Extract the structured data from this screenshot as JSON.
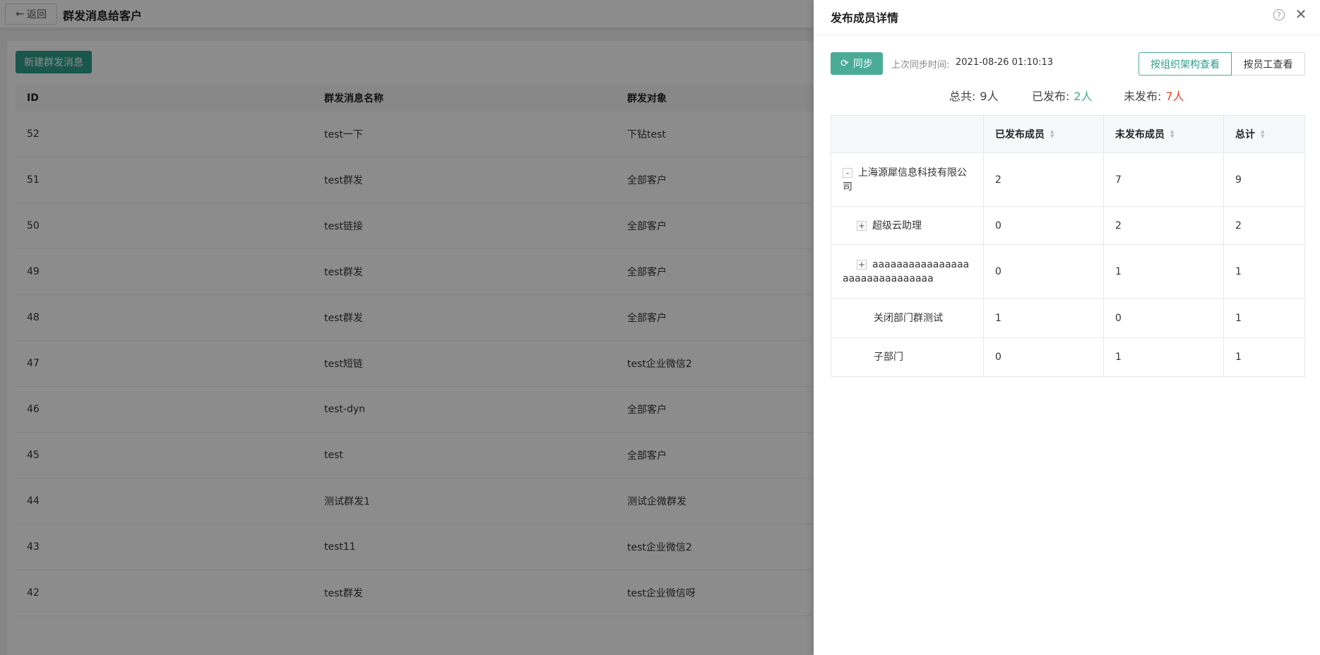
{
  "page": {
    "back_label": "返回",
    "title": "群发消息给客户",
    "new_button": "新建群发消息",
    "columns": [
      "ID",
      "群发消息名称",
      "群发对象"
    ],
    "rows": [
      {
        "id": "52",
        "name": "test一下",
        "target": "下钻test"
      },
      {
        "id": "51",
        "name": "test群发",
        "target": "全部客户"
      },
      {
        "id": "50",
        "name": "test链接",
        "target": "全部客户"
      },
      {
        "id": "49",
        "name": "test群发",
        "target": "全部客户"
      },
      {
        "id": "48",
        "name": "test群发",
        "target": "全部客户"
      },
      {
        "id": "47",
        "name": "test短链",
        "target": "test企业微信2"
      },
      {
        "id": "46",
        "name": "test-dyn",
        "target": "全部客户"
      },
      {
        "id": "45",
        "name": "test",
        "target": "全部客户"
      },
      {
        "id": "44",
        "name": "测试群发1",
        "target": "测试企微群发"
      },
      {
        "id": "43",
        "name": "test11",
        "target": "test企业微信2"
      },
      {
        "id": "42",
        "name": "test群发",
        "target": "test企业微信呀"
      }
    ]
  },
  "drawer": {
    "title": "发布成员详情",
    "help_icon": "question-circle-icon",
    "close_icon": "close-icon",
    "sync_button": "同步",
    "sync_label": "上次同步时间:",
    "sync_time": "2021-08-26 01:10:13",
    "view_by_org": "按组织架构查看",
    "view_by_staff": "按员工查看",
    "summary": {
      "total_label": "总共:",
      "total_value": "9人",
      "published_label": "已发布:",
      "published_value": "2人",
      "unpublished_label": "未发布:",
      "unpublished_value": "7人"
    },
    "columns": [
      "",
      "已发布成员",
      "未发布成员",
      "总计"
    ],
    "rows": [
      {
        "toggle": "-",
        "name": "上海源犀信息科技有限公司",
        "published": "2",
        "unpublished": "7",
        "total": "9"
      },
      {
        "toggle": "+",
        "name": "超级云助理",
        "published": "0",
        "unpublished": "2",
        "total": "2"
      },
      {
        "toggle": "+",
        "name": "aaaaaaaaaaaaaaaaaaaaaaaaaaaaaaa",
        "published": "0",
        "unpublished": "1",
        "total": "1"
      },
      {
        "toggle": "",
        "name": "关闭部门群测试",
        "published": "1",
        "unpublished": "0",
        "total": "1"
      },
      {
        "toggle": "",
        "name": "子部门",
        "published": "0",
        "unpublished": "1",
        "total": "1"
      }
    ],
    "colors": {
      "accent": "#4aab97",
      "published": "#3fb27f",
      "unpublished": "#e4481f"
    }
  }
}
